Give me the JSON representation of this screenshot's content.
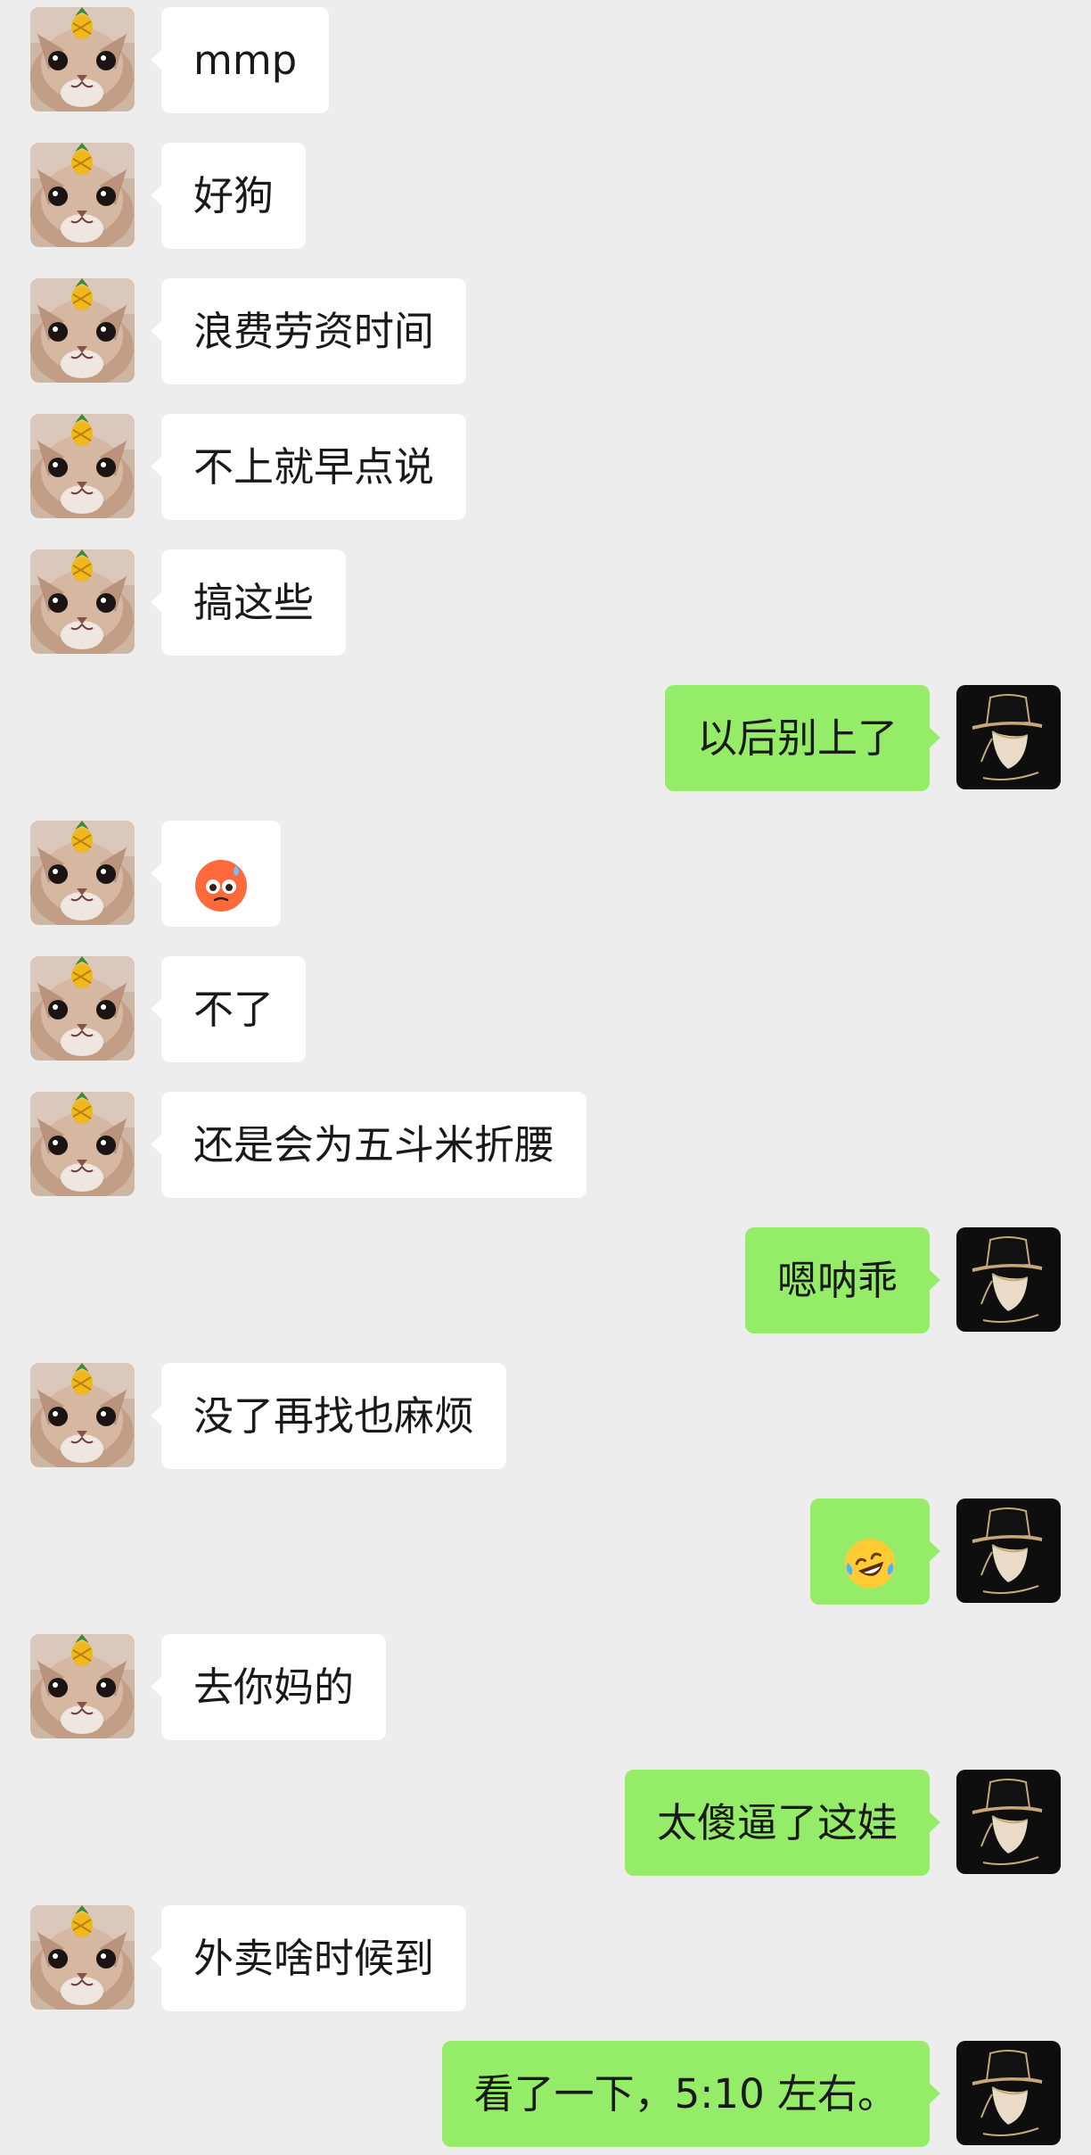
{
  "conversation": {
    "messages": [
      {
        "sender": "contact",
        "text": "mmp"
      },
      {
        "sender": "contact",
        "text": "好狗"
      },
      {
        "sender": "contact",
        "text": "浪费劳资时间"
      },
      {
        "sender": "contact",
        "text": "不上就早点说"
      },
      {
        "sender": "contact",
        "text": "搞这些"
      },
      {
        "sender": "me",
        "text": "以后别上了"
      },
      {
        "sender": "contact",
        "emoji": "sweating-flushed-face-emoji"
      },
      {
        "sender": "contact",
        "text": "不了"
      },
      {
        "sender": "contact",
        "text": "还是会为五斗米折腰"
      },
      {
        "sender": "me",
        "text": "嗯呐乖"
      },
      {
        "sender": "contact",
        "text": "没了再找也麻烦"
      },
      {
        "sender": "me",
        "emoji": "rolling-on-floor-laughing-emoji"
      },
      {
        "sender": "contact",
        "text": "去你妈的"
      },
      {
        "sender": "me",
        "text": "太傻逼了这娃"
      },
      {
        "sender": "contact",
        "text": "外卖啥时候到"
      },
      {
        "sender": "me",
        "text": "看了一下，5:10 左右。"
      }
    ]
  },
  "avatars": {
    "contact": "cat-with-pineapple-avatar",
    "me": "man-in-hat-avatar"
  },
  "colors": {
    "background": "#ededed",
    "incoming_bubble": "#ffffff",
    "outgoing_bubble": "#95ec69",
    "text": "#191919"
  }
}
